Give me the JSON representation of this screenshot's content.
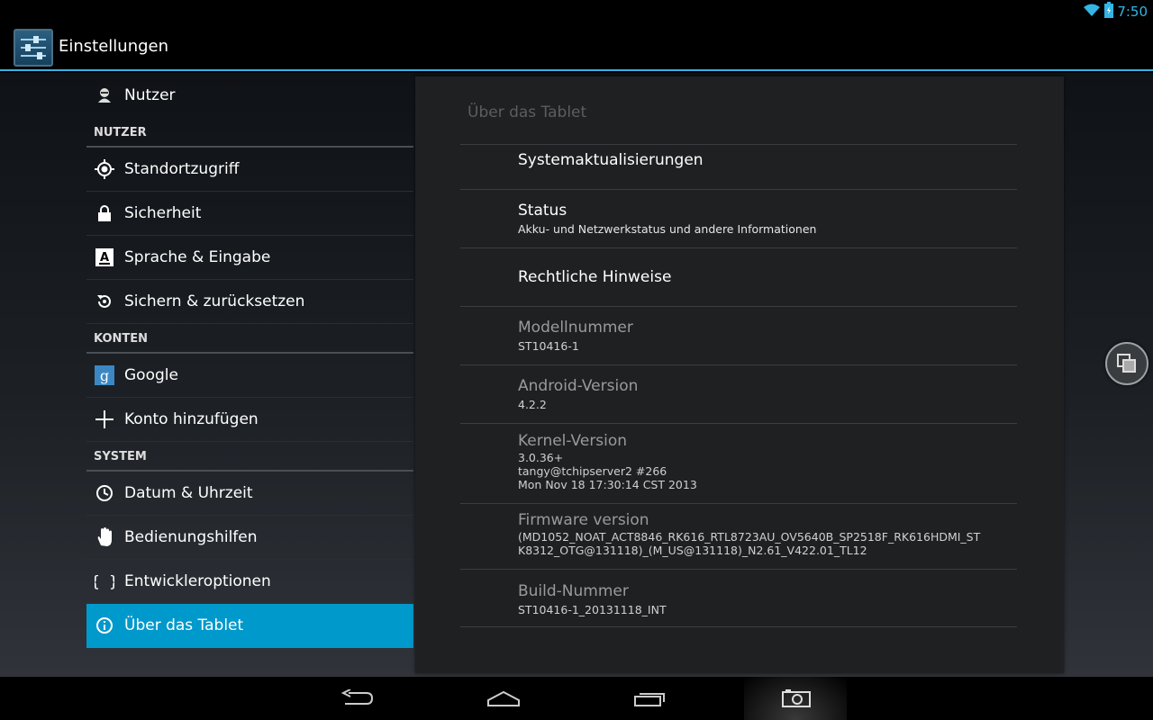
{
  "status_bar": {
    "time": "7:50",
    "accent_color": "#33b5e5",
    "icons": [
      "wifi-icon",
      "battery-icon"
    ]
  },
  "action_bar": {
    "title": "Einstellungen",
    "icon": "settings-sliders-icon"
  },
  "sidebar": {
    "top_item": {
      "label": "Nutzer",
      "icon": "user-icon"
    },
    "sections": [
      {
        "header": "NUTZER",
        "items": [
          {
            "label": "Standortzugriff",
            "icon": "location-icon"
          },
          {
            "label": "Sicherheit",
            "icon": "lock-icon"
          },
          {
            "label": "Sprache & Eingabe",
            "icon": "keyboard-a-icon"
          },
          {
            "label": "Sichern & zurücksetzen",
            "icon": "backup-restore-icon"
          }
        ]
      },
      {
        "header": "KONTEN",
        "items": [
          {
            "label": "Google",
            "icon": "google-g-icon"
          },
          {
            "label": "Konto hinzufügen",
            "icon": "plus-icon"
          }
        ]
      },
      {
        "header": "SYSTEM",
        "items": [
          {
            "label": "Datum & Uhrzeit",
            "icon": "clock-icon"
          },
          {
            "label": "Bedienungshilfen",
            "icon": "hand-icon"
          },
          {
            "label": "Entwickleroptionen",
            "icon": "braces-icon"
          },
          {
            "label": "Über das Tablet",
            "icon": "info-icon",
            "selected": true
          }
        ]
      }
    ],
    "selected_color": "#0099cc"
  },
  "detail": {
    "title": "Über das Tablet",
    "items": [
      {
        "title": "Systemaktualisierungen",
        "subtitle": []
      },
      {
        "title": "Status",
        "subtitle": [
          "Akku- und Netzwerkstatus und andere Informationen"
        ]
      },
      {
        "title": "Rechtliche Hinweise",
        "subtitle": []
      },
      {
        "title": "Modellnummer",
        "subtitle": [
          "ST10416-1"
        ]
      },
      {
        "title": "Android-Version",
        "subtitle": [
          "4.2.2"
        ]
      },
      {
        "title": "Kernel-Version",
        "subtitle": [
          "3.0.36+",
          "tangy@tchipserver2 #266",
          "Mon Nov 18 17:30:14 CST 2013"
        ]
      },
      {
        "title": "Firmware version",
        "subtitle": [
          "(MD1052_NOAT_ACT8846_RK616_RTL8723AU_OV5640B_SP2518F_RK616HDMI_ST",
          "K8312_OTG@131118)_(M_US@131118)_N2.61_V422.01_TL12"
        ]
      },
      {
        "title": "Build-Nummer",
        "subtitle": [
          "ST10416-1_20131118_INT"
        ]
      }
    ]
  },
  "floating_button": {
    "icon": "multi-window-icon"
  },
  "nav_bar": {
    "buttons": [
      "back-icon",
      "home-icon",
      "recents-icon",
      "screenshot-camera-icon"
    ]
  }
}
